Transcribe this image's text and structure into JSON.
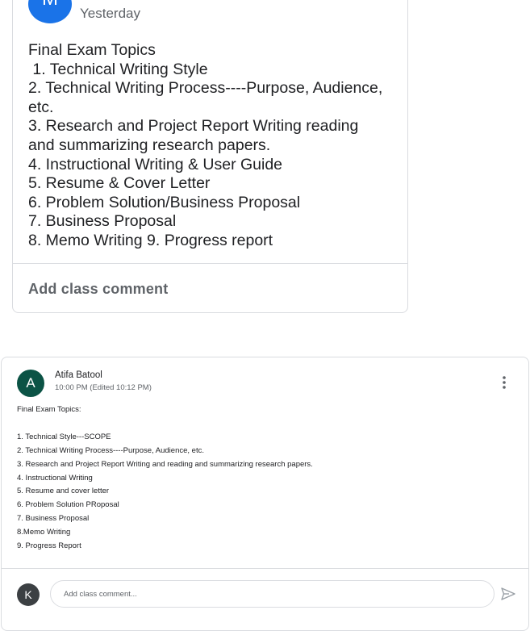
{
  "post1": {
    "avatar_letter": "M",
    "date": "Yesterday",
    "body_lines": [
      "Final Exam Topics",
      " 1. Technical Writing Style",
      "2. Technical Writing Process----Purpose, Audience,",
      "etc.",
      "3. Research and Project Report Writing reading",
      "and summarizing research papers.",
      "4. Instructional Writing & User Guide",
      "5. Resume & Cover Letter",
      "6. Problem Solution/Business Proposal",
      "7. Business Proposal",
      "8. Memo Writing 9. Progress report"
    ],
    "add_comment_label": "Add class comment"
  },
  "post2": {
    "avatar_letter": "A",
    "author": "Atifa Batool",
    "time": "10:00 PM (Edited 10:12 PM)",
    "title": "Final Exam Topics:",
    "items": [
      "1. Technical Style---SCOPE",
      "2. Technical Writing Process----Purpose, Audience, etc.",
      "3. Research and Project Report Writing and reading and summarizing research papers.",
      "4. Instructional Writing",
      "5. Resume and cover letter",
      "6. Problem Solution PRoposal",
      "7. Business Proposal",
      "8.Memo Writing",
      "9. Progress Report"
    ],
    "more_icon": "more-vert-icon",
    "commenter_avatar_letter": "K",
    "comment_placeholder": "Add class comment...",
    "send_icon": "send-icon"
  },
  "colors": {
    "avatar_blue": "#1a73e8",
    "avatar_green": "#0b5345",
    "avatar_gray": "#3c4043",
    "border": "#dadce0"
  }
}
